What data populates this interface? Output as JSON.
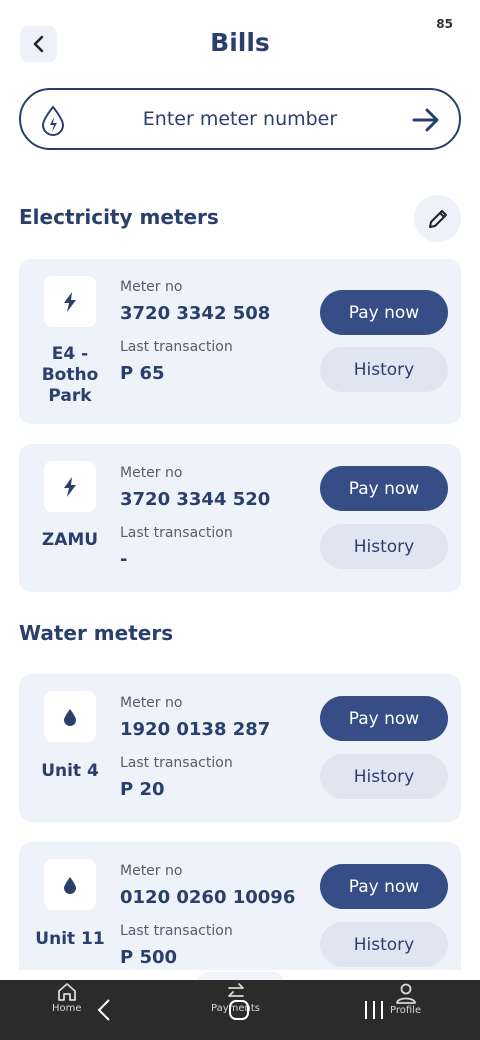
{
  "status": {
    "battery": "85"
  },
  "header": {
    "title": "Bills"
  },
  "search": {
    "placeholder": "Enter meter number"
  },
  "electricity": {
    "title": "Electricity meters",
    "meters": [
      {
        "name": "E4 -\nBotho\nPark",
        "meter_label": "Meter no",
        "meter_no": "3720 3342 508",
        "txn_label": "Last transaction",
        "txn": "P 65",
        "pay": "Pay now",
        "history": "History"
      },
      {
        "name": "ZAMU",
        "meter_label": "Meter no",
        "meter_no": "3720 3344 520",
        "txn_label": "Last transaction",
        "txn": "-",
        "pay": "Pay now",
        "history": "History"
      }
    ]
  },
  "water": {
    "title": "Water meters",
    "meters": [
      {
        "name": "Unit 4",
        "meter_label": "Meter no",
        "meter_no": "1920 0138 287",
        "txn_label": "Last transaction",
        "txn": "P 20",
        "pay": "Pay now",
        "history": "History"
      },
      {
        "name": "Unit 11",
        "meter_label": "Meter no",
        "meter_no": "0120 0260 10096",
        "txn_label": "Last transaction",
        "txn": "P 500",
        "pay": "Pay now",
        "history": "History"
      }
    ]
  },
  "nav": {
    "home": "Home",
    "payments": "Payments",
    "profile": "Profile"
  },
  "colors": {
    "primary": "#364d86",
    "text": "#2b3f6c",
    "card": "#eef3fa",
    "secondary_button": "#dfe6f2"
  }
}
